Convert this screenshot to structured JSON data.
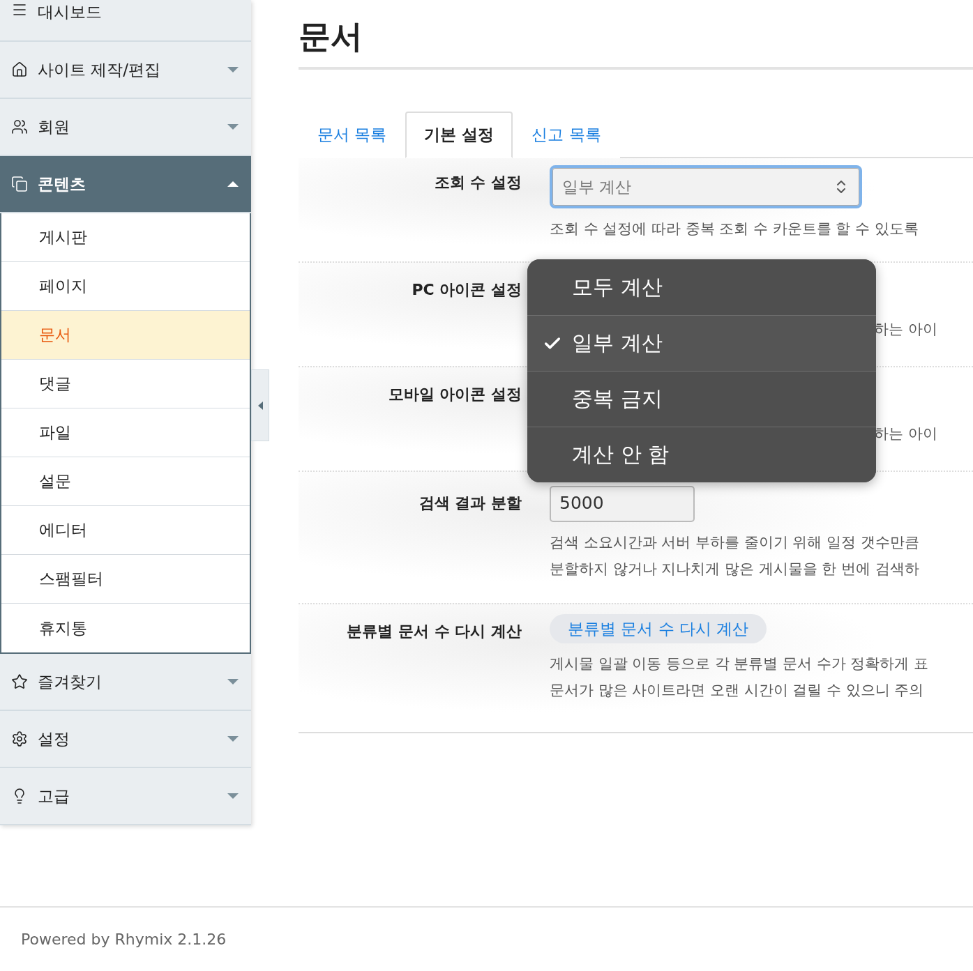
{
  "sidebar": {
    "items": [
      {
        "label": "대시보드"
      },
      {
        "label": "사이트 제작/편집",
        "expanded": false
      },
      {
        "label": "회원",
        "expanded": false
      },
      {
        "label": "콘텐츠",
        "expanded": true,
        "children": [
          {
            "label": "게시판",
            "selected": false
          },
          {
            "label": "페이지",
            "selected": false
          },
          {
            "label": "문서",
            "selected": true
          },
          {
            "label": "댓글",
            "selected": false
          },
          {
            "label": "파일",
            "selected": false
          },
          {
            "label": "설문",
            "selected": false
          },
          {
            "label": "에디터",
            "selected": false
          },
          {
            "label": "스팸필터",
            "selected": false
          },
          {
            "label": "휴지통",
            "selected": false
          }
        ]
      },
      {
        "label": "즐겨찾기",
        "expanded": false
      },
      {
        "label": "설정",
        "expanded": false
      },
      {
        "label": "고급",
        "expanded": false
      }
    ]
  },
  "page_title": "문서",
  "tabs": [
    {
      "label": "문서 목록",
      "selected": false
    },
    {
      "label": "기본 설정",
      "selected": true
    },
    {
      "label": "신고 목록",
      "selected": false
    }
  ],
  "settings": [
    {
      "label": "조회 수 설정",
      "kind": "select",
      "value": "일부 계산",
      "help": [
        "조회 수 설정에 따라 중복 조회 수 카운트를 할 수 있도록"
      ]
    },
    {
      "label": "PC 아이콘 설정",
      "kind": "blank",
      "help": [
        "하는 아이"
      ]
    },
    {
      "label": "모바일 아이콘 설정",
      "kind": "blank",
      "help": [
        "하는 아이"
      ]
    },
    {
      "label": "검색 결과 분할",
      "kind": "input",
      "value": "5000",
      "help": [
        "검색 소요시간과 서버 부하를 줄이기 위해 일정 갯수만큼",
        "분할하지 않거나 지나치게 많은 게시물을 한 번에 검색하"
      ]
    },
    {
      "label": "분류별 문서 수 다시 계산",
      "kind": "button",
      "value": "분류별 문서 수 다시 계산",
      "help": [
        "게시물 일괄 이동 등으로 각 분류별 문서 수가 정확하게 표",
        "문서가 많은 사이트라면 오랜 시간이 걸릴 수 있으니 주의"
      ]
    }
  ],
  "dropdown": {
    "options": [
      {
        "label": "모두 계산",
        "selected": false
      },
      {
        "label": "일부 계산",
        "selected": true
      },
      {
        "label": "중복 금지",
        "selected": false
      },
      {
        "label": "계산 안 함",
        "selected": false
      }
    ]
  },
  "footer": "Powered by Rhymix 2.1.26"
}
